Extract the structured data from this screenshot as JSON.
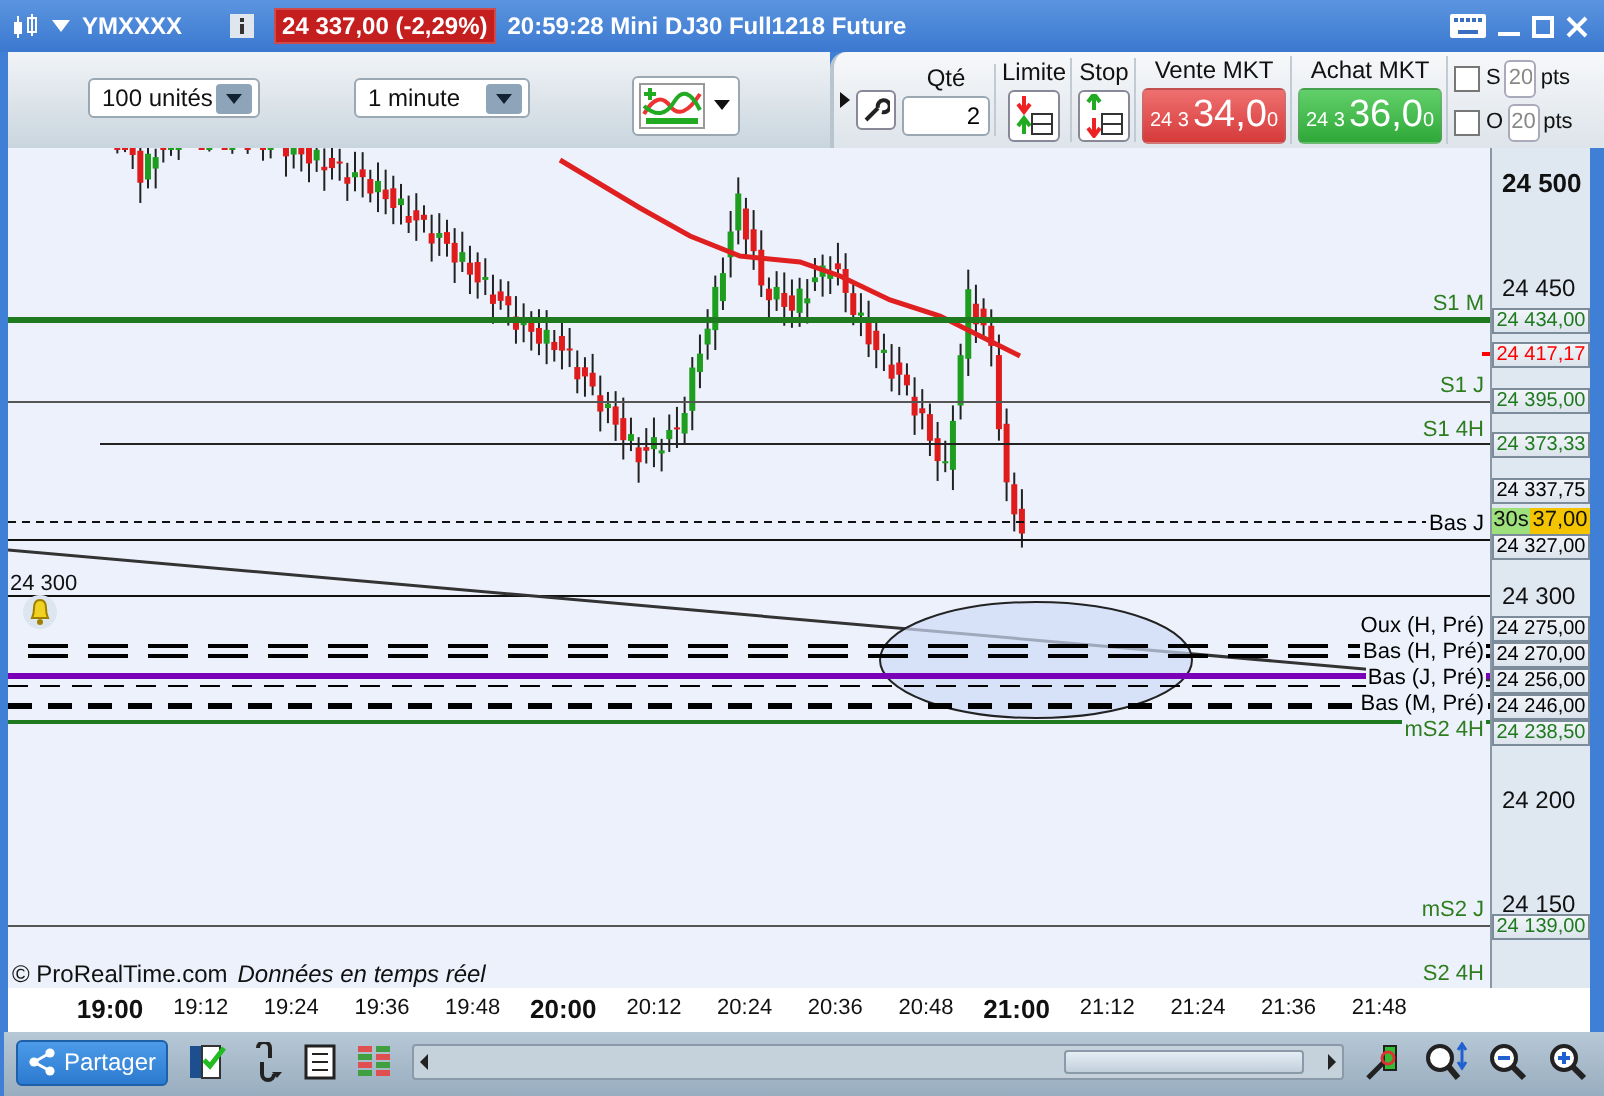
{
  "title_bar": {
    "symbol": "YMXXXX",
    "quote": "24 337,00 (-2,29%)",
    "info": "20:59:28 Mini DJ30 Full1218 Future"
  },
  "toolbar": {
    "units": "100 unités",
    "period": "1 minute"
  },
  "order_panel": {
    "qty_label": "Qté",
    "qty": "2",
    "limit_label": "Limite",
    "stop_label": "Stop",
    "sell": {
      "label": "Vente MKT",
      "prefix": "24 3",
      "price": "34,0",
      "suffix": "0"
    },
    "buy": {
      "label": "Achat MKT",
      "prefix": "24 3",
      "price": "36,0",
      "suffix": "0"
    },
    "options": [
      {
        "label": "S",
        "checked": false,
        "value": "20",
        "unit": "pts"
      },
      {
        "label": "O",
        "checked": false,
        "value": "20",
        "unit": "pts"
      }
    ]
  },
  "chart": {
    "price_ticks": [
      "24 500",
      "24 450",
      "24 300",
      "24 200",
      "24 150"
    ],
    "line_label": "24 300",
    "level_labels": [
      {
        "text": "S1 M",
        "color": "#2e7d1e"
      },
      {
        "text": "S1 J",
        "color": "#2e7d1e"
      },
      {
        "text": "S1 4H",
        "color": "#2e7d1e"
      },
      {
        "text": "Bas J",
        "color": "#000000"
      },
      {
        "text": "Oux (H, Pré)",
        "color": "#000000"
      },
      {
        "text": "Bas (H, Pré)",
        "color": "#000000"
      },
      {
        "text": "Bas (J, Pré)",
        "color": "#000000"
      },
      {
        "text": "Bas (M, Pré)",
        "color": "#000000"
      },
      {
        "text": "mS2 4H",
        "color": "#2e7d1e"
      },
      {
        "text": "mS2 J",
        "color": "#2e7d1e"
      },
      {
        "text": "S2 4H",
        "color": "#2e7d1e"
      }
    ],
    "price_tags": [
      {
        "text": "24 434,00",
        "color": "#1f7a1f"
      },
      {
        "text": "24 417,17",
        "color": "#ff0000"
      },
      {
        "text": "24 395,00",
        "color": "#1f7a1f"
      },
      {
        "text": "24 373,33",
        "color": "#1f7a1f"
      },
      {
        "text": "24 337,75",
        "color": "#000000"
      },
      {
        "text": "24 327,00",
        "color": "#000000"
      },
      {
        "text": "24 275,00",
        "color": "#000000"
      },
      {
        "text": "24 270,00",
        "color": "#000000"
      },
      {
        "text": "24 256,00",
        "color": "#000000"
      },
      {
        "text": "24 246,00",
        "color": "#000000"
      },
      {
        "text": "24 238,50",
        "color": "#1f7a1f"
      },
      {
        "text": "24 139,00",
        "color": "#1f7a1f"
      }
    ],
    "countdown": {
      "timer": "30s",
      "price": "37,00"
    },
    "copyright": "© ProRealTime.com",
    "feed": "Données en temps réel",
    "time_ticks": [
      {
        "label": "19:00",
        "major": true
      },
      {
        "label": "19:12",
        "major": false
      },
      {
        "label": "19:24",
        "major": false
      },
      {
        "label": "19:36",
        "major": false
      },
      {
        "label": "19:48",
        "major": false
      },
      {
        "label": "20:00",
        "major": true
      },
      {
        "label": "20:12",
        "major": false
      },
      {
        "label": "20:24",
        "major": false
      },
      {
        "label": "20:36",
        "major": false
      },
      {
        "label": "20:48",
        "major": false
      },
      {
        "label": "21:00",
        "major": true
      },
      {
        "label": "21:12",
        "major": false
      },
      {
        "label": "21:24",
        "major": false
      },
      {
        "label": "21:36",
        "major": false
      },
      {
        "label": "21:48",
        "major": false
      }
    ]
  },
  "bottom_bar": {
    "share": "Partager"
  }
}
